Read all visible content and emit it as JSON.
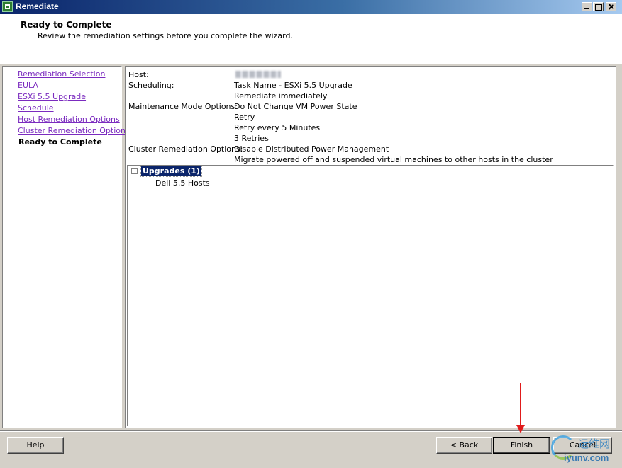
{
  "window": {
    "title": "Remediate",
    "controls": [
      "minimize",
      "maximize",
      "close"
    ]
  },
  "header": {
    "title": "Ready to Complete",
    "subtitle": "Review the remediation settings before you complete the wizard."
  },
  "sidebar": {
    "items": [
      {
        "label": "Remediation Selection",
        "current": false
      },
      {
        "label": "EULA",
        "current": false
      },
      {
        "label": "ESXi 5.5 Upgrade",
        "current": false
      },
      {
        "label": "Schedule",
        "current": false
      },
      {
        "label": "Host Remediation Options",
        "current": false
      },
      {
        "label": "Cluster Remediation Options",
        "current": false
      },
      {
        "label": "Ready to Complete",
        "current": true
      }
    ]
  },
  "summary": {
    "host_label": "Host:",
    "scheduling_label": "Scheduling:",
    "scheduling_values": [
      "Task Name - ESXi 5.5 Upgrade",
      "Remediate immediately"
    ],
    "maintenance_label": "Maintenance Mode Options:",
    "maintenance_values": [
      "Do Not Change VM Power State",
      "Retry",
      "Retry every 5 Minutes",
      "3 Retries"
    ],
    "cluster_label": "Cluster Remediation Options:",
    "cluster_values": [
      "Disable Distributed Power Management",
      "Migrate powered off and suspended virtual machines to other hosts in the cluster"
    ]
  },
  "tree": {
    "root_label": "Upgrades (1)",
    "children": [
      "Dell 5.5 Hosts"
    ]
  },
  "buttons": {
    "help": "Help",
    "back": "< Back",
    "finish": "Finish",
    "cancel": "Cancel"
  },
  "watermark": {
    "chinese": "运维网",
    "url": "iyunv.com"
  },
  "colors": {
    "annotation_arrow": "#e01b1b",
    "link": "#7b2bbf",
    "selection": "#0a246a"
  }
}
